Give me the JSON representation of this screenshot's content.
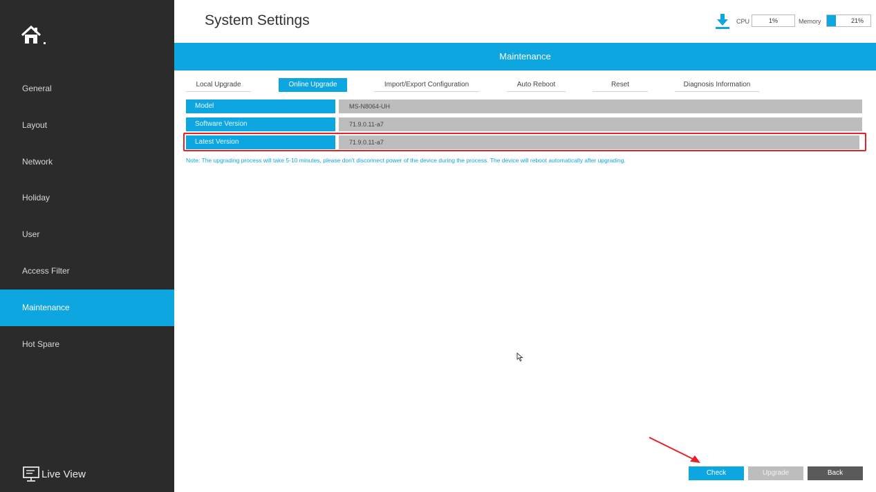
{
  "header": {
    "title": "System Settings",
    "cpu_label": "CPU",
    "cpu_value": "1%",
    "memory_label": "Memory",
    "memory_value": "21%",
    "memory_fraction": 0.21,
    "download_icon": "download-icon"
  },
  "sidebar": {
    "home_icon": "home-icon",
    "items": [
      {
        "label": "General"
      },
      {
        "label": "Layout"
      },
      {
        "label": "Network"
      },
      {
        "label": "Holiday"
      },
      {
        "label": "User"
      },
      {
        "label": "Access Filter"
      },
      {
        "label": "Maintenance",
        "active": true
      },
      {
        "label": "Hot Spare"
      }
    ],
    "live_view_label": "Live View"
  },
  "banner": {
    "title": "Maintenance"
  },
  "tabs": [
    {
      "label": "Local Upgrade"
    },
    {
      "label": "Online Upgrade",
      "active": true
    },
    {
      "label": "Import/Export Configuration"
    },
    {
      "label": "Auto Reboot"
    },
    {
      "label": "Reset"
    },
    {
      "label": "Diagnosis Information"
    }
  ],
  "info": {
    "model_label": "Model",
    "model_value": "MS-N8064-UH",
    "software_label": "Software Version",
    "software_value": "71.9.0.11-a7",
    "latest_label": "Latest Version",
    "latest_value": "71.9.0.11-a7"
  },
  "note": "Note: The upgrading process will take 5-10 minutes, please don't disconnect power of the device during the process. The device will reboot automatically after upgrading.",
  "buttons": {
    "check": "Check",
    "upgrade": "Upgrade",
    "back": "Back"
  },
  "colors": {
    "accent": "#0ea6e0",
    "sidebar_bg": "#2b2b2b",
    "highlight": "#e8202a"
  }
}
